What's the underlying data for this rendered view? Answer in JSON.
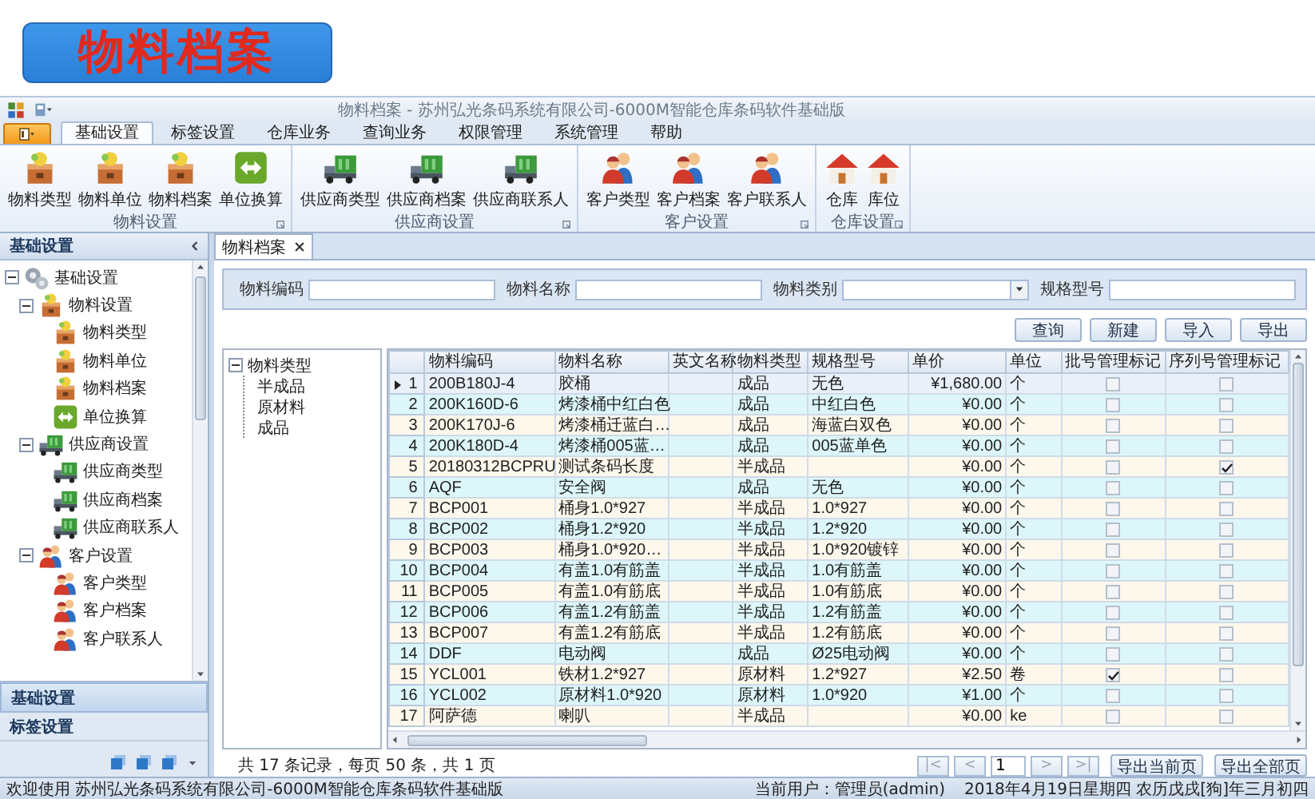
{
  "banner": {
    "title": "物料档案"
  },
  "window": {
    "title": "物料档案 - 苏州弘光条码系统有限公司-6000M智能仓库条码软件基础版"
  },
  "ribbon_tabs": [
    {
      "label": "基础设置",
      "selected": true
    },
    {
      "label": "标签设置",
      "selected": false
    },
    {
      "label": "仓库业务",
      "selected": false
    },
    {
      "label": "查询业务",
      "selected": false
    },
    {
      "label": "权限管理",
      "selected": false
    },
    {
      "label": "系统管理",
      "selected": false
    },
    {
      "label": "帮助",
      "selected": false
    }
  ],
  "ribbon_groups": [
    {
      "title": "物料设置",
      "buttons": [
        {
          "label": "物料类型",
          "kind": "box"
        },
        {
          "label": "物料单位",
          "kind": "box"
        },
        {
          "label": "物料档案",
          "kind": "box"
        },
        {
          "label": "单位换算",
          "kind": "swap"
        }
      ]
    },
    {
      "title": "供应商设置",
      "buttons": [
        {
          "label": "供应商类型",
          "kind": "truck"
        },
        {
          "label": "供应商档案",
          "kind": "truck"
        },
        {
          "label": "供应商联系人",
          "kind": "truck"
        }
      ]
    },
    {
      "title": "客户设置",
      "buttons": [
        {
          "label": "客户类型",
          "kind": "people"
        },
        {
          "label": "客户档案",
          "kind": "people"
        },
        {
          "label": "客户联系人",
          "kind": "people"
        }
      ]
    },
    {
      "title": "仓库设置",
      "buttons": [
        {
          "label": "仓库",
          "kind": "house"
        },
        {
          "label": "库位",
          "kind": "house"
        }
      ]
    }
  ],
  "nav": {
    "title": "基础设置",
    "tree": [
      {
        "label": "基础设置",
        "kind": "gears",
        "expanded": true,
        "children": [
          {
            "label": "物料设置",
            "kind": "box",
            "expanded": true,
            "children": [
              {
                "label": "物料类型",
                "kind": "box"
              },
              {
                "label": "物料单位",
                "kind": "box"
              },
              {
                "label": "物料档案",
                "kind": "box"
              },
              {
                "label": "单位换算",
                "kind": "swap"
              }
            ]
          },
          {
            "label": "供应商设置",
            "kind": "truck",
            "expanded": true,
            "children": [
              {
                "label": "供应商类型",
                "kind": "truck"
              },
              {
                "label": "供应商档案",
                "kind": "truck"
              },
              {
                "label": "供应商联系人",
                "kind": "truck"
              }
            ]
          },
          {
            "label": "客户设置",
            "kind": "people",
            "expanded": true,
            "children": [
              {
                "label": "客户类型",
                "kind": "people"
              },
              {
                "label": "客户档案",
                "kind": "people"
              },
              {
                "label": "客户联系人",
                "kind": "people"
              }
            ]
          }
        ]
      }
    ],
    "sections": [
      {
        "label": "基础设置",
        "selected": true
      },
      {
        "label": "标签设置",
        "selected": false
      }
    ]
  },
  "document_tabs": [
    {
      "label": "物料档案",
      "selected": true
    }
  ],
  "filters": [
    {
      "label": "物料编码",
      "kind": "text"
    },
    {
      "label": "物料名称",
      "kind": "text"
    },
    {
      "label": "物料类别",
      "kind": "select"
    },
    {
      "label": "规格型号",
      "kind": "text"
    }
  ],
  "actions": [
    "查询",
    "新建",
    "导入",
    "导出"
  ],
  "category_tree": [
    {
      "label": "物料类型",
      "expanded": true,
      "children": [
        {
          "label": "半成品"
        },
        {
          "label": "原材料"
        },
        {
          "label": "成品"
        }
      ]
    }
  ],
  "table": {
    "columns": [
      "物料编码",
      "物料名称",
      "英文名称",
      "物料类型",
      "规格型号",
      "单价",
      "单位",
      "批号管理标记",
      "序列号管理标记"
    ],
    "rows": [
      {
        "no": "1",
        "code": "200B180J-4",
        "name": "胶桶",
        "type": "成品",
        "spec": "无色",
        "price": "¥1,680.00",
        "unit": "个",
        "batch": false,
        "serial": false,
        "selected": true
      },
      {
        "no": "2",
        "code": "200K160D-6",
        "name": "烤漆桶中红白色",
        "type": "成品",
        "spec": "中红白色",
        "price": "¥0.00",
        "unit": "个",
        "batch": false,
        "serial": false,
        "selected": false
      },
      {
        "no": "3",
        "code": "200K170J-6",
        "name": "烤漆桶迁蓝白…",
        "type": "成品",
        "spec": "海蓝白双色",
        "price": "¥0.00",
        "unit": "个",
        "batch": false,
        "serial": false,
        "selected": false
      },
      {
        "no": "4",
        "code": "200K180D-4",
        "name": "烤漆桶005蓝…",
        "type": "成品",
        "spec": "005蓝单色",
        "price": "¥0.00",
        "unit": "个",
        "batch": false,
        "serial": false,
        "selected": false
      },
      {
        "no": "5",
        "code": "20180312BCPRU",
        "name": "测试条码长度",
        "type": "半成品",
        "price": "¥0.00",
        "unit": "个",
        "batch": false,
        "serial": true,
        "selected": false
      },
      {
        "no": "6",
        "code": "AQF",
        "name": "安全阀",
        "type": "成品",
        "spec": "无色",
        "price": "¥0.00",
        "unit": "个",
        "batch": false,
        "serial": false,
        "selected": false
      },
      {
        "no": "7",
        "code": "BCP001",
        "name": "桶身1.0*927",
        "type": "半成品",
        "spec": "1.0*927",
        "price": "¥0.00",
        "unit": "个",
        "batch": false,
        "serial": false,
        "selected": false
      },
      {
        "no": "8",
        "code": "BCP002",
        "name": "桶身1.2*920",
        "type": "半成品",
        "spec": "1.2*920",
        "price": "¥0.00",
        "unit": "个",
        "batch": false,
        "serial": false,
        "selected": false
      },
      {
        "no": "9",
        "code": "BCP003",
        "name": "桶身1.0*920…",
        "type": "半成品",
        "spec": "1.0*920镀锌",
        "price": "¥0.00",
        "unit": "个",
        "batch": false,
        "serial": false,
        "selected": false
      },
      {
        "no": "10",
        "code": "BCP004",
        "name": "有盖1.0有筋盖",
        "type": "半成品",
        "spec": "1.0有筋盖",
        "price": "¥0.00",
        "unit": "个",
        "batch": false,
        "serial": false,
        "selected": false
      },
      {
        "no": "11",
        "code": "BCP005",
        "name": "有盖1.0有筋底",
        "type": "半成品",
        "spec": "1.0有筋底",
        "price": "¥0.00",
        "unit": "个",
        "batch": false,
        "serial": false,
        "selected": false
      },
      {
        "no": "12",
        "code": "BCP006",
        "name": "有盖1.2有筋盖",
        "type": "半成品",
        "spec": "1.2有筋盖",
        "price": "¥0.00",
        "unit": "个",
        "batch": false,
        "serial": false,
        "selected": false
      },
      {
        "no": "13",
        "code": "BCP007",
        "name": "有盖1.2有筋底",
        "type": "半成品",
        "spec": "1.2有筋底",
        "price": "¥0.00",
        "unit": "个",
        "batch": false,
        "serial": false,
        "selected": false
      },
      {
        "no": "14",
        "code": "DDF",
        "name": "电动阀",
        "type": "成品",
        "spec": "Ø25电动阀",
        "price": "¥0.00",
        "unit": "个",
        "batch": false,
        "serial": false,
        "selected": false
      },
      {
        "no": "15",
        "code": "YCL001",
        "name": "铁材1.2*927",
        "type": "原材料",
        "spec": "1.2*927",
        "price": "¥2.50",
        "unit": "卷",
        "batch": true,
        "serial": false,
        "selected": false
      },
      {
        "no": "16",
        "code": "YCL002",
        "name": "原材料1.0*920",
        "type": "原材料",
        "spec": "1.0*920",
        "price": "¥1.00",
        "unit": "个",
        "batch": false,
        "serial": false,
        "selected": false
      },
      {
        "no": "17",
        "code": "阿萨德",
        "name": "喇叭",
        "type": "半成品",
        "price": "¥0.00",
        "unit": "ke",
        "batch": false,
        "serial": false,
        "selected": false
      }
    ]
  },
  "pager": {
    "summary": "共 17 条记录，每页 50 条，共 1 页",
    "nav_buttons": [
      {
        "label": "|<",
        "disabled": true
      },
      {
        "label": "<",
        "disabled": true
      },
      {
        "label": ">",
        "disabled": true
      },
      {
        "label": ">|",
        "disabled": true
      }
    ],
    "page": "1",
    "export_buttons": [
      "导出当前页",
      "导出全部页"
    ]
  },
  "status_bar": {
    "welcome": "欢迎使用 苏州弘光条码系统有限公司-6000M智能仓库条码软件基础版",
    "user": "当前用户：管理员(admin)",
    "date": "2018年4月19日星期四 农历戊戌[狗]年三月初四"
  }
}
